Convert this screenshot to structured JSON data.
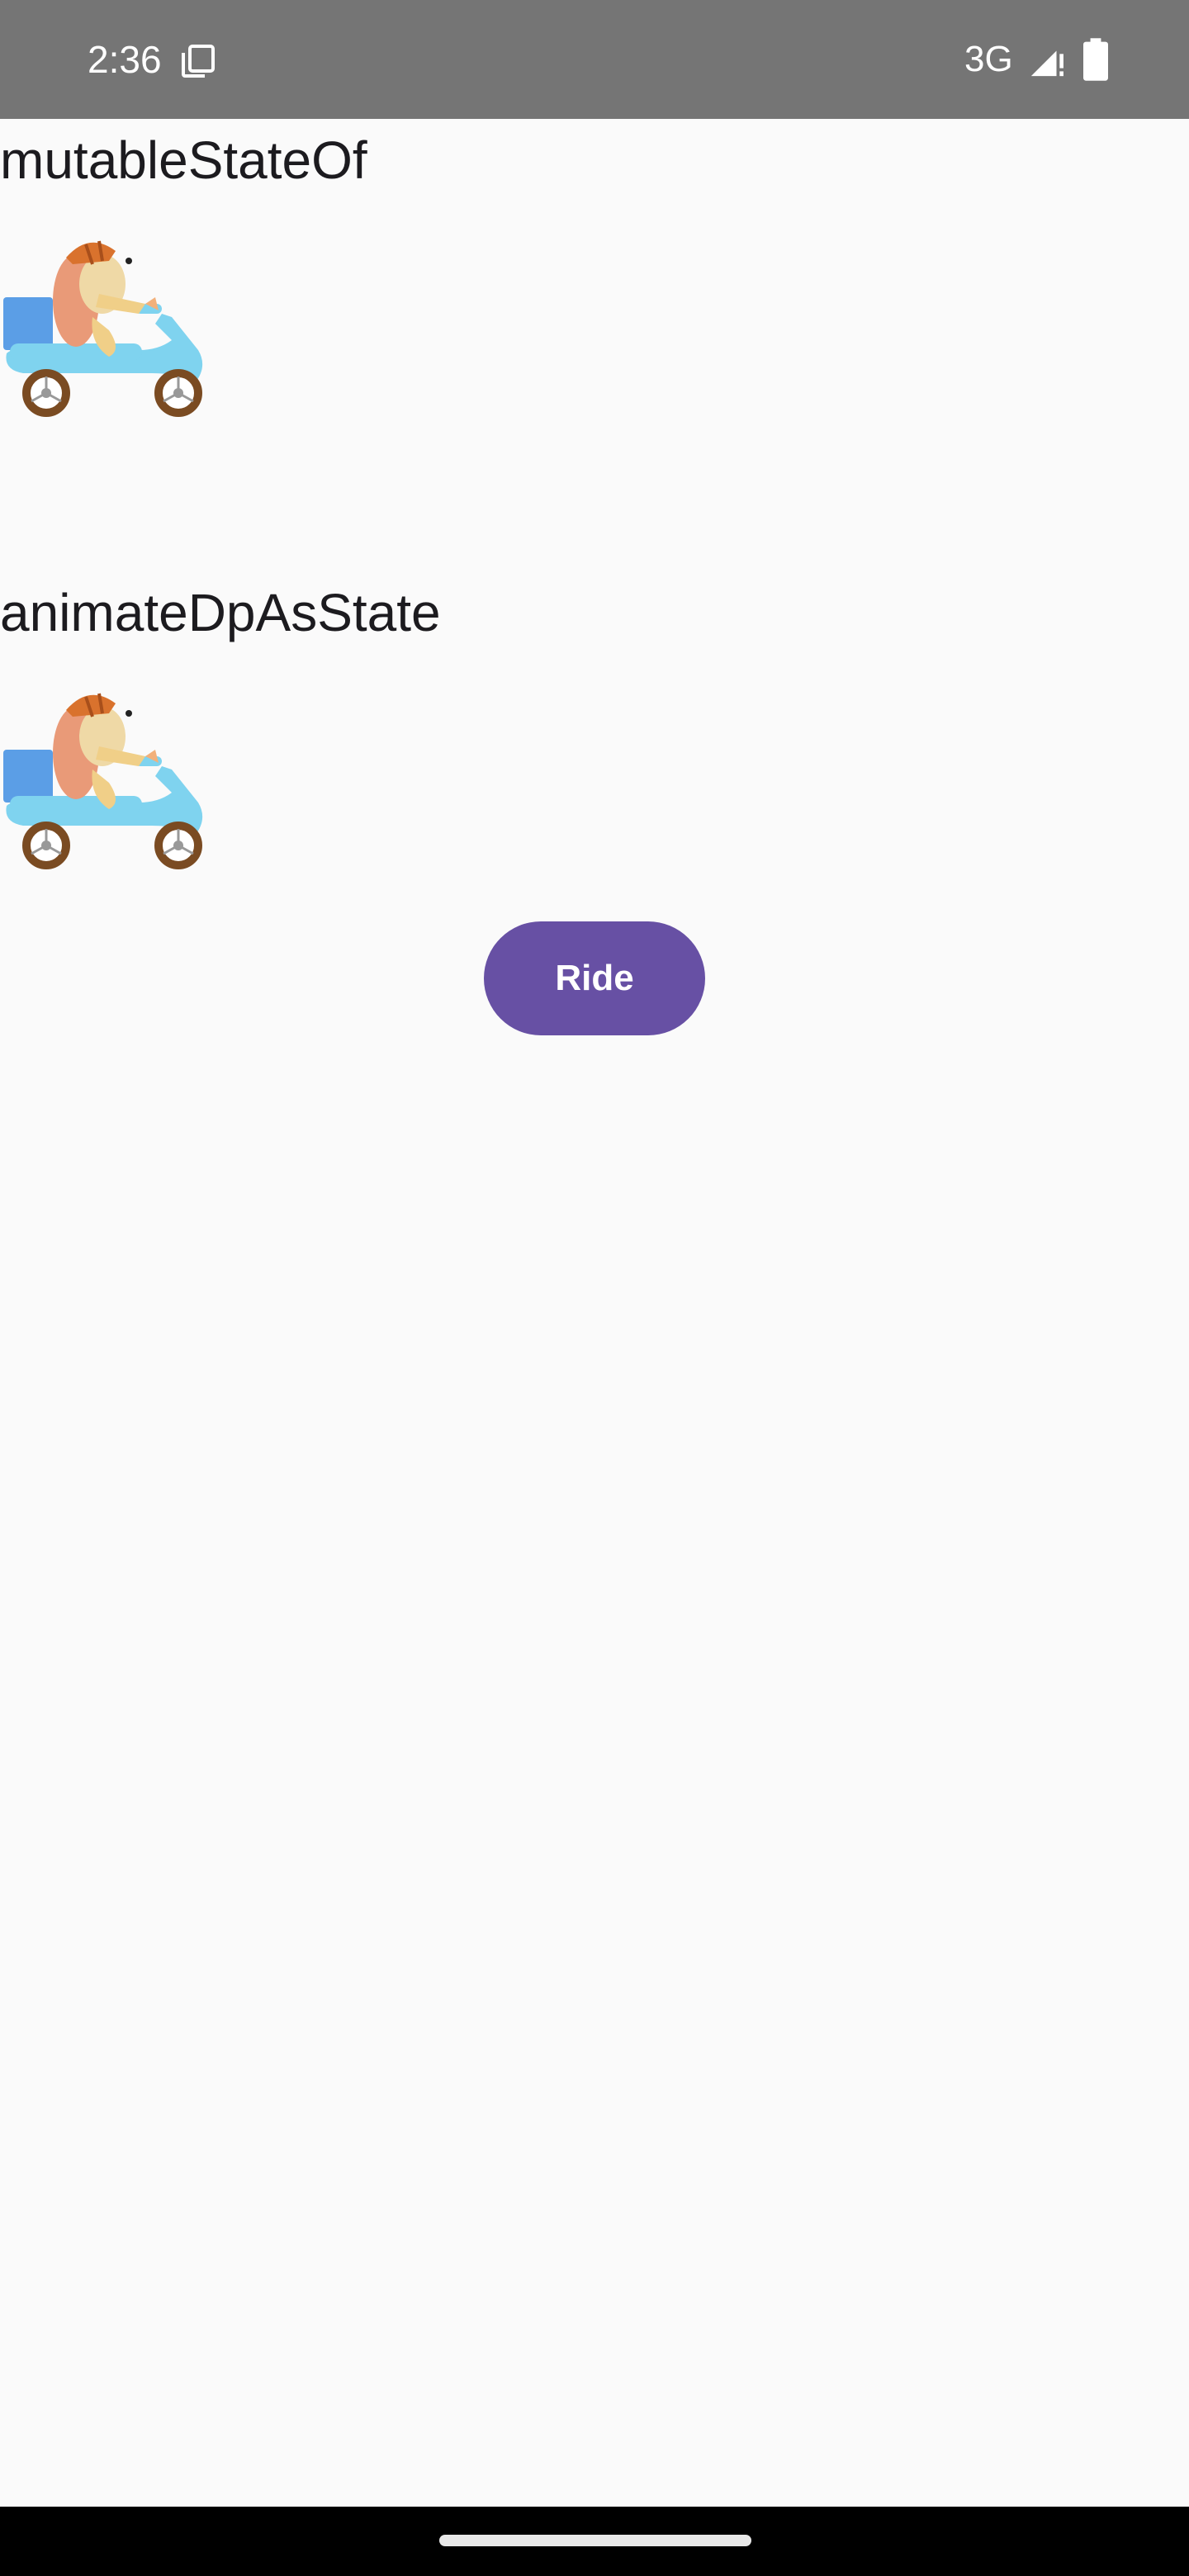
{
  "status_bar": {
    "time": "2:36",
    "network": "3G",
    "icons": [
      "screenshot-icon",
      "signal-icon",
      "battery-icon"
    ],
    "background": "#757575"
  },
  "sections": [
    {
      "title": "mutableStateOf",
      "image": "scooter-rider-icon"
    },
    {
      "title": "animateDpAsState",
      "image": "scooter-rider-icon"
    }
  ],
  "ride_button": {
    "label": "Ride",
    "color": "#6750a4"
  },
  "colors": {
    "background": "#fafafa",
    "text": "#1c1b1f"
  }
}
